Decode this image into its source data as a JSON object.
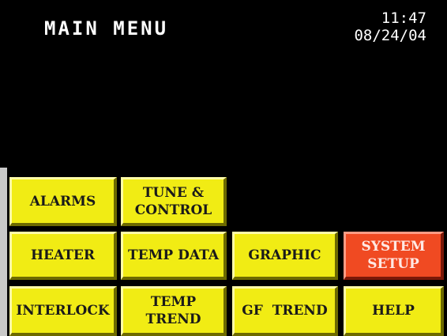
{
  "header": {
    "title": "MAIN MENU",
    "time": "11:47",
    "date": "08/24/04"
  },
  "buttons": {
    "alarms": {
      "line1": "ALARMS",
      "line2": ""
    },
    "tune_control": {
      "line1": "TUNE &",
      "line2": "CONTROL"
    },
    "heater": {
      "line1": "HEATER",
      "line2": ""
    },
    "temp_data": {
      "line1": "TEMP DATA",
      "line2": ""
    },
    "graphic": {
      "line1": "GRAPHIC",
      "line2": ""
    },
    "system_setup": {
      "line1": "SYSTEM",
      "line2": "SETUP"
    },
    "interlock": {
      "line1": "INTERLOCK",
      "line2": ""
    },
    "temp_trend": {
      "line1": "TEMP",
      "line2": "TREND"
    },
    "gf_trend": {
      "line1": "GF  TREND",
      "line2": ""
    },
    "help": {
      "line1": "HELP",
      "line2": ""
    }
  },
  "colors": {
    "background": "#000000",
    "button": "#f1ec14",
    "alert_button": "#f04a22",
    "text": "#ffffff"
  }
}
